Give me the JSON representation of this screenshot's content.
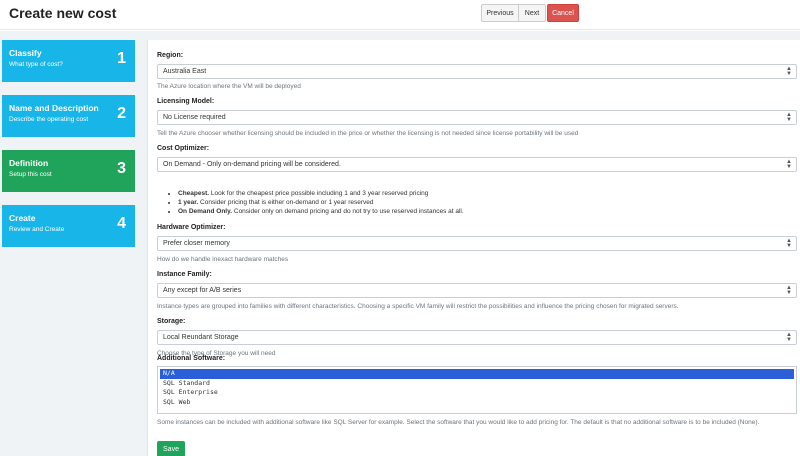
{
  "header": {
    "title": "Create new cost",
    "previous_label": "Previous",
    "next_label": "Next",
    "cancel_label": "Cancel"
  },
  "steps": [
    {
      "title": "Classify",
      "subtitle": "What type of cost?",
      "number": "1",
      "state": "pending"
    },
    {
      "title": "Name and Description",
      "subtitle": "Describe the operating cost",
      "number": "2",
      "state": "pending"
    },
    {
      "title": "Definition",
      "subtitle": "Setup this cost",
      "number": "3",
      "state": "active"
    },
    {
      "title": "Create",
      "subtitle": "Review and Create",
      "number": "4",
      "state": "pending"
    }
  ],
  "form": {
    "region": {
      "label": "Region:",
      "value": "Australia East",
      "help": "The Azure location where the VM will be deployed"
    },
    "licensing": {
      "label": "Licensing Model:",
      "value": "No License required",
      "help": "Tell the Azure chooser whether licensing should be included in the price or whether the licensing is not needed since license portability will be used"
    },
    "cost_optimizer": {
      "label": "Cost Optimizer:",
      "value": "On Demand - Only on-demand pricing will be considered.",
      "bullets": [
        {
          "bold": "Cheapest.",
          "text": " Look for the cheapest price possible including 1 and 3 year reserved pricing"
        },
        {
          "bold": "1 year.",
          "text": " Consider pricing that is either on-demand or 1 year reserved"
        },
        {
          "bold": "On Demand Only.",
          "text": " Consider only on demand pricing and do not try to use reserved instances at all."
        }
      ]
    },
    "hardware_optimizer": {
      "label": "Hardware Optimizer:",
      "value": "Prefer closer memory",
      "help": "How do we handle inexact hardware matches"
    },
    "instance_family": {
      "label": "Instance Family:",
      "value": "Any except for A/B series",
      "help": "Instance types are grouped into families with different characteristics. Choosing a specific VM family will restrict the possibilities and influence the pricing chosen for migrated servers."
    },
    "storage": {
      "label": "Storage:",
      "value": "Local Reundant Storage",
      "help": "Choose the type of Storage you will need"
    },
    "additional_software": {
      "label": "Additional Software:",
      "options": [
        "N/A",
        "SQL Standard",
        "SQL Enterprise",
        "SQL Web"
      ],
      "selected": "N/A",
      "help": "Some instances can be included with additional software like SQL Server for example. Select the software that you would like to add pricing for. The default is that no additional software is to be included (None)."
    },
    "save_label": "Save"
  }
}
